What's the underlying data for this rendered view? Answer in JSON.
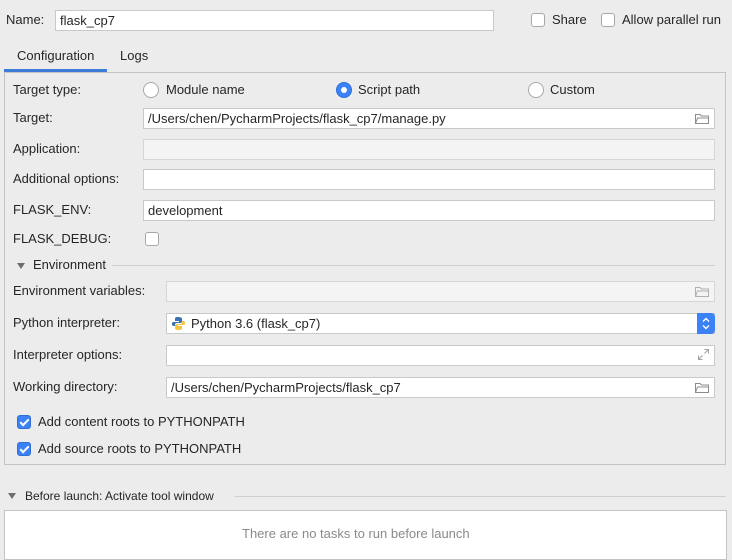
{
  "header": {
    "name_label": "Name:",
    "name_value": "flask_cp7",
    "share_label": "Share",
    "allow_parallel_label": "Allow parallel run"
  },
  "tabs": [
    {
      "label": "Configuration",
      "active": true
    },
    {
      "label": "Logs",
      "active": false
    }
  ],
  "config": {
    "target_type_label": "Target type:",
    "target_type_options": [
      "Module name",
      "Script path",
      "Custom"
    ],
    "target_type_selected": "Script path",
    "target_label": "Target:",
    "target_value": "/Users/chen/PycharmProjects/flask_cp7/manage.py",
    "application_label": "Application:",
    "application_value": "",
    "additional_options_label": "Additional options:",
    "additional_options_value": "",
    "flask_env_label": "FLASK_ENV:",
    "flask_env_value": "development",
    "flask_debug_label": "FLASK_DEBUG:",
    "flask_debug_checked": false
  },
  "environment": {
    "section_label": "Environment",
    "env_vars_label": "Environment variables:",
    "env_vars_value": "",
    "interpreter_label": "Python interpreter:",
    "interpreter_value": "Python 3.6 (flask_cp7)",
    "interp_options_label": "Interpreter options:",
    "interp_options_value": "",
    "working_dir_label": "Working directory:",
    "working_dir_value": "/Users/chen/PycharmProjects/flask_cp7",
    "content_roots_label": "Add content roots to PYTHONPATH",
    "content_roots_checked": true,
    "source_roots_label": "Add source roots to PYTHONPATH",
    "source_roots_checked": true
  },
  "before_launch": {
    "label": "Before launch: Activate tool window",
    "empty_text": "There are no tasks to run before launch"
  },
  "colors": {
    "accent": "#3b82f6",
    "tab_underline": "#3d7bd6",
    "background": "#ececec"
  }
}
